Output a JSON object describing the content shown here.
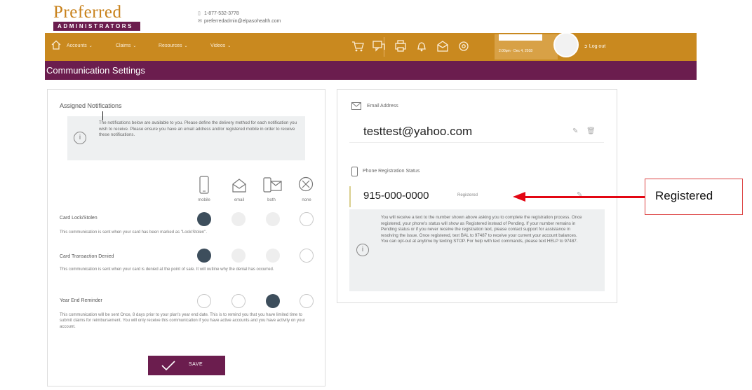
{
  "header": {
    "brand": "Preferred",
    "brand_tag": "ADMINISTRATORS",
    "phone": "1-877-532-3778",
    "email": "preferredadmin@elpasohealth.com"
  },
  "nav": {
    "items": [
      "Accounts",
      "Claims",
      "Resources",
      "Videos"
    ],
    "toolbar_icons": [
      "cart-icon",
      "chat-icon",
      "printer-icon",
      "bell-icon",
      "mail-icon",
      "gear-icon"
    ],
    "date_text": "2:00pm  ·  Dec 4, 2018",
    "logout": "Log out"
  },
  "page": {
    "title": "Communication Settings"
  },
  "notifications": {
    "title": "Assigned Notifications",
    "info": "The notifications below are available to you. Please define the delivery method for each notification you wish to receive. Please ensure you have an email address and/or registered mobile in order to receive these notifications.",
    "columns": [
      "mobile",
      "email",
      "both",
      "none"
    ],
    "rows": [
      {
        "label": "Card Lock/Stolen",
        "desc": "This communication is sent when your card has been marked as \"Lock/Stolen\".",
        "states": [
          "on",
          "dis",
          "dis",
          "off"
        ]
      },
      {
        "label": "Card Transaction Denied",
        "desc": "This communication is sent when your card is denied at the point of sale. It will outline why the denial has occurred.",
        "states": [
          "on",
          "dis",
          "dis",
          "off"
        ]
      },
      {
        "label": "Year End Reminder",
        "desc": "This communication will be sent Once, 8 days prior to your plan's year end date. This is to remind you that you have limited time to submit claims for reimbursement. You will only receive this communication if you have active accounts and you have activity on your account.",
        "states": [
          "off",
          "off",
          "on",
          "off"
        ]
      }
    ],
    "save_label": "SAVE"
  },
  "contact": {
    "email_label": "Email Address",
    "email_value": "testtest@yahoo.com",
    "phone_label": "Phone Registration Status",
    "phone_value": "915-000-0000",
    "phone_status": "Registered",
    "info": "You will receive a text to the number shown above asking you to complete the registration process. Once registered, your phone's status will show as Registered instead of Pending. If your number remains in Pending status or if you never receive the registration text, please contact support for assistance in resolving the issue. Once registered, text BAL to 97487 to receive your current your account balances. You can opt-out at anytime by texting STOP. For help with text commands, please text HELP to 97487."
  },
  "annotation": {
    "label": "Registered"
  },
  "colors": {
    "gold": "#c9891f",
    "purple": "#6b1d4e",
    "radio_on": "#3d4e5c",
    "arrow": "#e30613"
  }
}
